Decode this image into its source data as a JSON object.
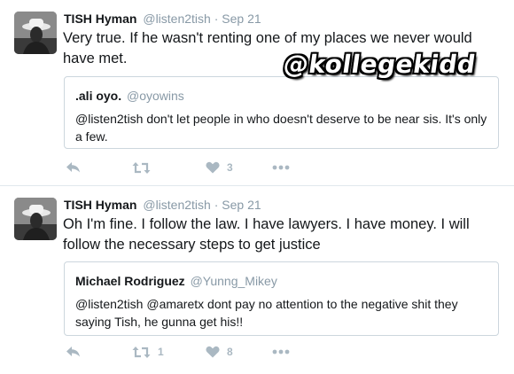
{
  "watermark": "@kollegekidd",
  "colors": {
    "secondary_text": "#8899a6",
    "action_icon": "#aab8c2",
    "border": "#ccd6dd"
  },
  "tweets": [
    {
      "author_name": "TISH Hyman",
      "author_handle": "@listen2tish",
      "separator": "·",
      "date": "Sep 21",
      "text": "Very true. If he wasn't renting one of my places we never would have met.",
      "quote": {
        "name": ".ali oyo.",
        "handle": "@oyowins",
        "text": "@listen2tish don't let people in who doesn't deserve to be near sis. It's only a few."
      },
      "actions": {
        "reply_icon": "reply-icon",
        "retweet_icon": "retweet-icon",
        "retweet_count": "",
        "like_icon": "heart-icon",
        "like_count": "3",
        "more_icon": "more-icon"
      }
    },
    {
      "author_name": "TISH Hyman",
      "author_handle": "@listen2tish",
      "separator": "·",
      "date": "Sep 21",
      "text": "Oh I'm fine. I follow the law. I have lawyers. I have money. I will follow the necessary steps to get justice",
      "quote": {
        "name": "Michael Rodriguez",
        "handle": "@Yunng_Mikey",
        "text": "@listen2tish @amaretx  dont pay no attention to the negative shit they saying Tish, he gunna get his!!"
      },
      "actions": {
        "reply_icon": "reply-icon",
        "retweet_icon": "retweet-icon",
        "retweet_count": "1",
        "like_icon": "heart-icon",
        "like_count": "8",
        "more_icon": "more-icon"
      }
    }
  ]
}
